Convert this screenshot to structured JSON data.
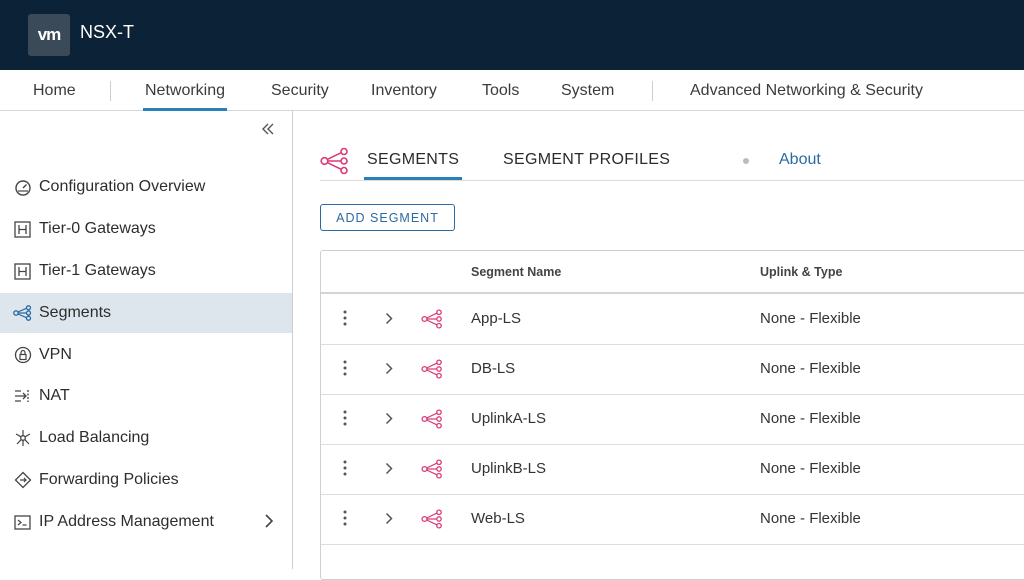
{
  "header": {
    "logo_text": "vm",
    "product": "NSX-T",
    "bg_color": "#0c2236"
  },
  "nav": {
    "items": [
      {
        "label": "Home"
      },
      {
        "label": "Networking",
        "active": true
      },
      {
        "label": "Security"
      },
      {
        "label": "Inventory"
      },
      {
        "label": "Tools"
      },
      {
        "label": "System"
      },
      {
        "label": "Advanced Networking & Security"
      }
    ],
    "accent": "#2a7fb9"
  },
  "sidebar": {
    "collapse_icon": "double-chevron-left-icon",
    "items": [
      {
        "label": "Configuration Overview",
        "icon": "dashboard-icon"
      },
      {
        "label": "Tier-0 Gateways",
        "icon": "gateway-icon"
      },
      {
        "label": "Tier-1 Gateways",
        "icon": "gateway-icon"
      },
      {
        "label": "Segments",
        "icon": "segment-icon",
        "active": true
      },
      {
        "label": "VPN",
        "icon": "vpn-lock-icon"
      },
      {
        "label": "NAT",
        "icon": "nat-icon"
      },
      {
        "label": "Load Balancing",
        "icon": "load-balancer-icon"
      },
      {
        "label": "Forwarding Policies",
        "icon": "forwarding-icon"
      },
      {
        "label": "IP Address Management",
        "icon": "terminal-icon",
        "has_children": true
      }
    ]
  },
  "tabs": {
    "segments": "SEGMENTS",
    "profiles": "SEGMENT PROFILES",
    "about": "About"
  },
  "toolbar": {
    "add_segment": "ADD SEGMENT"
  },
  "table": {
    "columns": {
      "name": "Segment Name",
      "uplink": "Uplink & Type"
    },
    "rows": [
      {
        "name": "App-LS",
        "uplink": "None - Flexible"
      },
      {
        "name": "DB-LS",
        "uplink": "None - Flexible"
      },
      {
        "name": "UplinkA-LS",
        "uplink": "None - Flexible"
      },
      {
        "name": "UplinkB-LS",
        "uplink": "None - Flexible"
      },
      {
        "name": "Web-LS",
        "uplink": "None - Flexible"
      }
    ],
    "segment_icon_color": "#d93a78"
  }
}
